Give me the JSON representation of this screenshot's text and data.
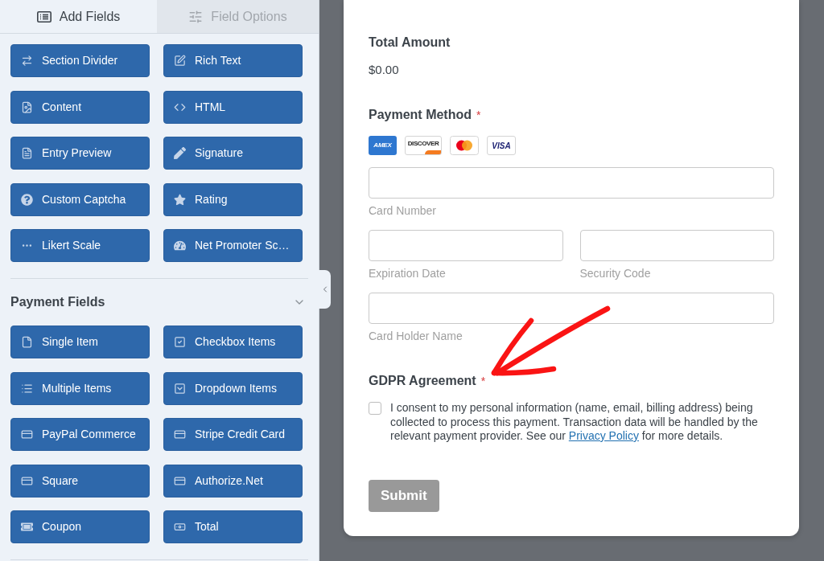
{
  "sidebar": {
    "tabs": [
      {
        "label": "Add Fields",
        "selected": true
      },
      {
        "label": "Field Options",
        "selected": false
      }
    ],
    "sections": [
      {
        "buttons": [
          "Section Divider",
          "Rich Text",
          "Content",
          "HTML",
          "Entry Preview",
          "Signature",
          "Custom Captcha",
          "Rating",
          "Likert Scale",
          "Net Promoter Sc…"
        ]
      },
      {
        "title": "Payment Fields",
        "expanded": true,
        "buttons": [
          "Single Item",
          "Checkbox Items",
          "Multiple Items",
          "Dropdown Items",
          "PayPal Commerce",
          "Stripe Credit Card",
          "Square",
          "Authorize.Net",
          "Coupon",
          "Total"
        ]
      }
    ]
  },
  "form": {
    "total": {
      "label": "Total Amount",
      "value": "$0.00"
    },
    "payment": {
      "label": "Payment Method",
      "required_mark": "*",
      "card_logos": [
        {
          "kind": "amex",
          "text": "AMEX"
        },
        {
          "kind": "discover",
          "text": "DISCOVER"
        },
        {
          "kind": "mastercard"
        },
        {
          "kind": "visa",
          "text": "VISA"
        }
      ],
      "rows": [
        {
          "fields": [
            {
              "label": "Card Number"
            }
          ]
        },
        {
          "fields": [
            {
              "label": "Expiration Date"
            },
            {
              "label": "Security Code"
            }
          ]
        },
        {
          "fields": [
            {
              "label": "Card Holder Name"
            }
          ]
        }
      ]
    },
    "gdpr": {
      "label": "GDPR Agreement",
      "required_mark": "*",
      "checked": false,
      "consent_before": "I consent to my personal information (name, email, billing address) being collected to process this payment. Transaction data will be handled by the relevant payment provider. See our ",
      "consent_link": "Privacy Policy",
      "consent_after": " for more details."
    },
    "submit": {
      "label": "Submit"
    }
  }
}
